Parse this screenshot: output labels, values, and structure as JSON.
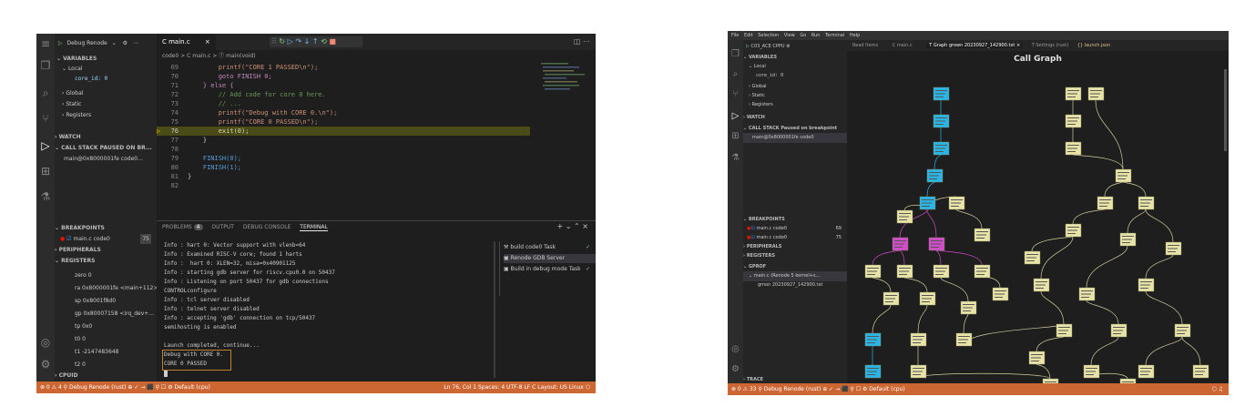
{
  "left": {
    "debug_label": "Debug Renode",
    "sidebar": {
      "variables": "VARIABLES",
      "local": "Local",
      "local_var": "core_id: 0",
      "global": "Global",
      "static": "Static",
      "registers": "Registers",
      "watch": "WATCH",
      "callstack": "CALL STACK   PAUSED ON BR...",
      "callstack_item": "main@0x8000001fe  code0...",
      "breakpoints": "BREAKPOINTS",
      "bp_item": "main.c  code0",
      "bp_count": "75",
      "peripherals": "PERIPHERALS",
      "registers2": "REGISTERS",
      "regs": [
        "zero 0",
        "ra 0x8000001fe <main+112>",
        "sp 0x8001f8d0",
        "gp 0x80007158 <irq_dev+...",
        "tp 0x0",
        "t0 0",
        "t1 -2147483648",
        "t2 0"
      ],
      "cpuid": "CPUID"
    },
    "tab": "C main.c",
    "breadcrumb": "code0 > C main.c > ⓕ main(void)",
    "code": [
      {
        "n": "69",
        "t": "        printf(\"CORE 1 PASSED\\n\");"
      },
      {
        "n": "70",
        "t": "        goto FINISH 0;"
      },
      {
        "n": "71",
        "t": "    } else {"
      },
      {
        "n": "72",
        "t": "        // Add code for core 0 here."
      },
      {
        "n": "73",
        "t": "        // ..."
      },
      {
        "n": "74",
        "t": "        printf(\"Debug with CORE 0.\\n\");"
      },
      {
        "n": "75",
        "t": "        printf(\"CORE 0 PASSED\\n\");"
      },
      {
        "n": "76",
        "t": "        exit(0);"
      },
      {
        "n": "77",
        "t": "    }"
      },
      {
        "n": "78",
        "t": ""
      },
      {
        "n": "79",
        "t": "    FINISH(0);"
      },
      {
        "n": "80",
        "t": "    FINISH(1);"
      },
      {
        "n": "81",
        "t": "}"
      },
      {
        "n": "82",
        "t": ""
      }
    ],
    "panel_tabs": [
      "PROBLEMS",
      "4",
      "OUTPUT",
      "DEBUG CONSOLE",
      "TERMINAL"
    ],
    "terminal": [
      "Info : hart 0: Vector support with vlenb=64",
      "Info : Examined RISC-V core; found 1 harts",
      "Info :  hart 0: XLEN=32, misa=0x40901125",
      "Info : starting gdb server for riscv.cpu0.0 on 50437",
      "Info : Listening on port 50437 for gdb connections",
      "CONTROLconfigure",
      "Info : tcl server disabled",
      "Info : telnet server disabled",
      "Info : accepting 'gdb' connection on tcp/50437",
      "semihosting is enabled",
      "",
      "Launch completed, continue...",
      "Debug with CORE 0.",
      "CORE 0 PASSED"
    ],
    "tasks": [
      "build code0 Task",
      "Renode GDB Server",
      "Build in debug mode Task"
    ],
    "status": {
      "left": "⊗ 0 ⚠ 4   ⚲ Debug Renode (rust)   ⊕   ✓   →   ⬛   ⚲   ☐   ⚙ Default (cpu)",
      "right": "Ln 76, Col 1   Spaces: 4   UTF-8   LF   C   Layout: US   Linux   ⬡"
    }
  },
  "right": {
    "menu": [
      "File",
      "Edit",
      "Selection",
      "View",
      "Go",
      "Run",
      "Terminal",
      "Help"
    ],
    "debug_label": "C03_ACE CPPU",
    "tabs": [
      "Read Items",
      "C main.c",
      "T Graph grown 20230927_142900.txt ×",
      "T Settings (rust)",
      "{} launch.json"
    ],
    "graph_title": "Call Graph",
    "sidebar": {
      "variables": "VARIABLES",
      "local": "Local",
      "local_var": "core_id: 0",
      "global": "Global",
      "static": "Static",
      "registers": "Registers",
      "watch": "WATCH",
      "callstack": "CALL STACK      Paused on breakpoint",
      "callstack_item": "main@0x8000001fe  code0",
      "breakpoints": "BREAKPOINTS",
      "bp1": "main.c  code0",
      "bp2": "main.c  code0",
      "bp1_n": "69",
      "bp2_n": "75",
      "peripherals": "PERIPHERALS",
      "registers2": "REGISTERS",
      "gprof": "GPROF",
      "gprof_item": "main.c (Renode 5 kernel+s...",
      "gprof_sub": "gmon 20230927_142900.txt",
      "trace": "TRACE"
    },
    "status": {
      "left": "⊗ 0 ⚠ 33   ⚲ Debug Renode (rust)   ⊕   ✓   →   ⬛   ⚲   ☐   ⚙ Default (cpu)",
      "right": "⬡   ♫"
    }
  }
}
